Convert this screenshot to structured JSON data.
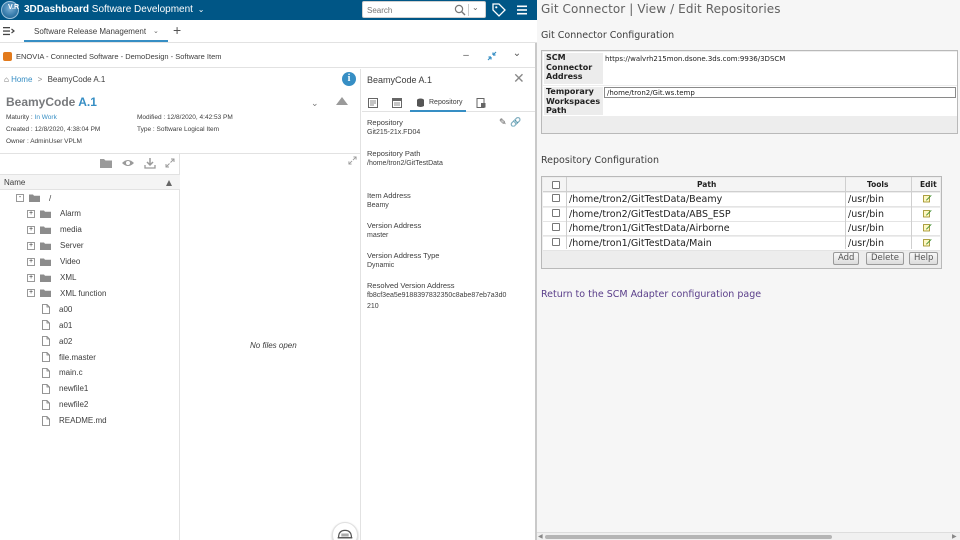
{
  "topbar": {
    "brand_bold": "3DDashboard",
    "brand_rest": "Software Development",
    "search_placeholder": "Search",
    "compass_label": "V.R"
  },
  "tabs": {
    "active_label": "Software Release Management"
  },
  "app": {
    "title": "ENOVIA - Connected Software - DemoDesign - Software Item"
  },
  "breadcrumb": {
    "home": "Home",
    "current": "BeamyCode A.1"
  },
  "object": {
    "name": "BeamyCode",
    "revision": "A.1",
    "maturity_label": "Maturity :",
    "maturity_value": "In Work",
    "modified_label": "Modified :",
    "modified_value": "12/8/2020, 4:42:53 PM",
    "created_label": "Created :",
    "created_value": "12/8/2020, 4:38:04 PM",
    "type_label": "Type :",
    "type_value": "Software Logical Item",
    "owner_label": "Owner :",
    "owner_value": "AdminUser VPLM"
  },
  "tree": {
    "column_header": "Name",
    "root": "/",
    "folders": [
      "Alarm",
      "media",
      "Server",
      "Video",
      "XML",
      "XML function"
    ],
    "files": [
      "a00",
      "a01",
      "a02",
      "file.master",
      "main.c",
      "newfile1",
      "newfile2",
      "README.md"
    ]
  },
  "editor": {
    "empty_text": "No files open"
  },
  "details": {
    "title": "BeamyCode A.1",
    "active_tab": "Repository",
    "fields": [
      {
        "label": "Repository",
        "value": "Git215-21x.FD04"
      },
      {
        "label": "Repository Path",
        "value": "/home/tron2/GitTestData"
      },
      {
        "label": "Item Address",
        "value": "Beamy"
      },
      {
        "label": "Version Address",
        "value": "master"
      },
      {
        "label": "Version Address Type",
        "value": "Dynamic"
      },
      {
        "label": "Resolved Version Address",
        "value": "fb8cf3ea5e9188397832350c8abe87eb7a3d0",
        "value2": "210"
      }
    ]
  },
  "git": {
    "page_title": "Git Connector | View / Edit Repositories",
    "config_heading": "Git Connector Configuration",
    "scm_label": "SCM Connector Address",
    "scm_value": "https://walvrh215mon.dsone.3ds.com:9936/3DSCM",
    "workspace_label": "Temporary Workspaces Path",
    "workspace_value": "/home/tron2/Git.ws.temp",
    "repo_heading": "Repository Configuration",
    "columns": {
      "path": "Path",
      "tools": "Tools",
      "edit": "Edit"
    },
    "repos": [
      {
        "path": "/home/tron2/GitTestData/Beamy",
        "tools": "/usr/bin"
      },
      {
        "path": "/home/tron2/GitTestData/ABS_ESP",
        "tools": "/usr/bin"
      },
      {
        "path": "/home/tron1/GitTestData/Airborne",
        "tools": "/usr/bin"
      },
      {
        "path": "/home/tron1/GitTestData/Main",
        "tools": "/usr/bin"
      }
    ],
    "buttons": {
      "add": "Add",
      "delete": "Delete",
      "help": "Help"
    },
    "return_link": "Return to the SCM Adapter configuration page"
  }
}
